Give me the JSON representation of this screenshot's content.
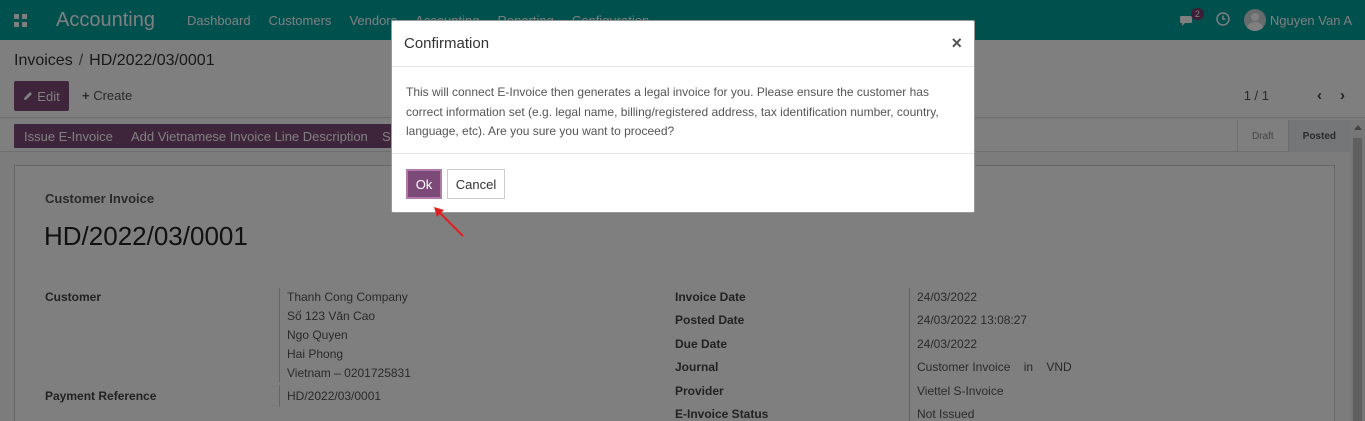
{
  "navbar": {
    "app_name": "Accounting",
    "menu": [
      "Dashboard",
      "Customers",
      "Vendors",
      "Accounting",
      "Reporting",
      "Configuration"
    ],
    "chat_count": "2",
    "user_name": "Nguyen Van A",
    "bg_color": "#00a09d"
  },
  "breadcrumb": {
    "parent": "Invoices",
    "separator": "/",
    "current": "HD/2022/03/0001"
  },
  "control": {
    "edit_label": "Edit",
    "create_label": "Create",
    "pager": "1 / 1"
  },
  "status_buttons": [
    "Issue E-Invoice",
    "Add Vietnamese Invoice Line Description",
    "Se"
  ],
  "stages": {
    "draft": "Draft",
    "posted": "Posted",
    "active": "Posted"
  },
  "sheet": {
    "doc_type": "Customer Invoice",
    "doc_name": "HD/2022/03/0001",
    "customer_label": "Customer",
    "customer_lines": [
      "Thanh Cong Company",
      "Số 123 Văn Cao",
      "Ngo Quyen",
      "Hai Phong",
      "Vietnam – 0201725831"
    ],
    "payment_ref_label": "Payment Reference",
    "payment_ref_value": "HD/2022/03/0001",
    "right_fields": [
      {
        "label": "Invoice Date",
        "value": "24/03/2022"
      },
      {
        "label": "Posted Date",
        "value": "24/03/2022 13:08:27"
      },
      {
        "label": "Due Date",
        "value": "24/03/2022"
      },
      {
        "label": "Journal",
        "value": "Customer Invoice    in    VND"
      },
      {
        "label": "Provider",
        "value": "Viettel S-Invoice"
      },
      {
        "label": "E-Invoice Status",
        "value": "Not Issued"
      }
    ]
  },
  "modal": {
    "title": "Confirmation",
    "close": "×",
    "body": "This will connect E-Invoice then generates a legal invoice for you. Please ensure the customer has correct information set (e.g. legal name, billing/registered address, tax identification number, country, language, etc). Are you sure you want to proceed?",
    "ok_label": "Ok",
    "cancel_label": "Cancel"
  },
  "colors": {
    "primary": "#7c4a78",
    "annotation_arrow": "#e02020"
  }
}
